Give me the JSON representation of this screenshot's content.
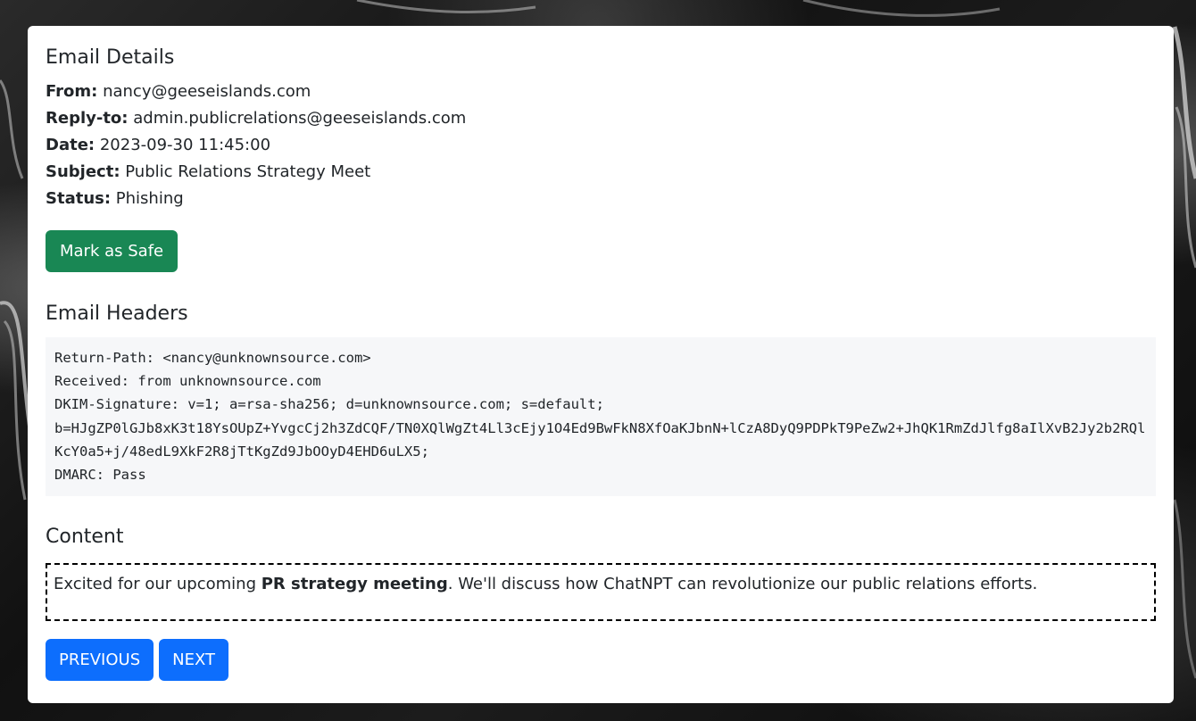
{
  "details": {
    "title": "Email Details",
    "from_label": "From:",
    "from_value": "nancy@geeseislands.com",
    "replyto_label": "Reply-to:",
    "replyto_value": "admin.publicrelations@geeseislands.com",
    "date_label": "Date:",
    "date_value": "2023-09-30 11:45:00",
    "subject_label": "Subject:",
    "subject_value": "Public Relations Strategy Meet",
    "status_label": "Status:",
    "status_value": "Phishing",
    "mark_safe_label": "Mark as Safe"
  },
  "headers": {
    "title": "Email Headers",
    "lines": {
      "return_path": "Return-Path: <nancy@unknownsource.com>",
      "received": "Received: from unknownsource.com",
      "dkim": "DKIM-Signature: v=1; a=rsa-sha256; d=unknownsource.com; s=default;",
      "b": "b=HJgZP0lGJb8xK3t18YsOUpZ+YvgcCj2h3ZdCQF/TN0XQlWgZt4Ll3cEjy1O4Ed9BwFkN8XfOaKJbnN+lCzA8DyQ9PDPkT9PeZw2+JhQK1RmZdJlfg8aIlXvB2Jy2b2RQlKcY0a5+j/48edL9XkF2R8jTtKgZd9JbOOyD4EHD6uLX5;",
      "dmarc": "DMARC: Pass"
    }
  },
  "content": {
    "title": "Content",
    "text_before": "Excited for our upcoming ",
    "text_bold": "PR strategy meeting",
    "text_after": ". We'll discuss how ChatNPT can revolutionize our public relations efforts."
  },
  "nav": {
    "previous_label": "Previous",
    "next_label": "Next"
  },
  "colors": {
    "safe_button": "#198754",
    "nav_button": "#0d6efd",
    "headers_background": "#f6f7f9"
  }
}
